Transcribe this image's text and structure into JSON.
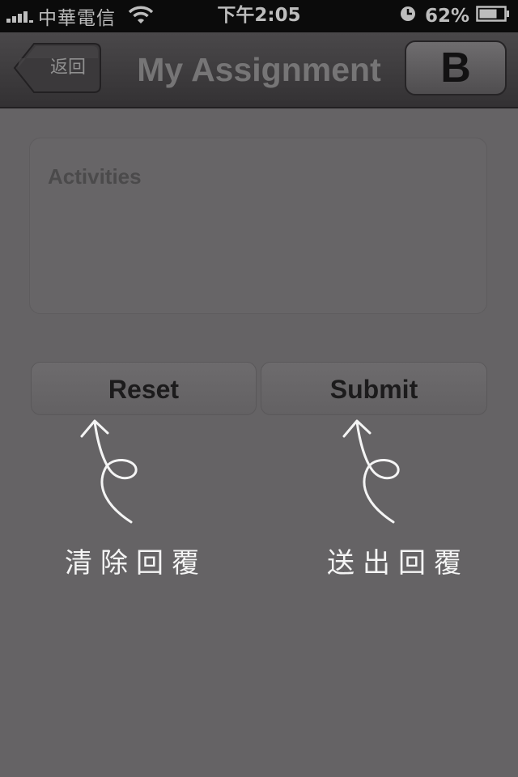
{
  "status_bar": {
    "carrier": "中華電信",
    "time": "下午2:05",
    "battery_percent": "62%",
    "icons": [
      "signal-bars-icon",
      "wifi-icon",
      "clock-icon",
      "battery-icon"
    ]
  },
  "nav": {
    "back_label": "返回",
    "title": "My Assignment",
    "right_button_label": "B"
  },
  "form": {
    "activities_label": "Activities"
  },
  "actions": {
    "reset_label": "Reset",
    "submit_label": "Submit"
  },
  "annotations": {
    "reset_note": "清除回覆",
    "submit_note": "送出回覆"
  },
  "colors": {
    "overlay_gray": "#656365",
    "annotation_white": "#f4f4f4",
    "status_bar_black": "#0b0b0b"
  }
}
